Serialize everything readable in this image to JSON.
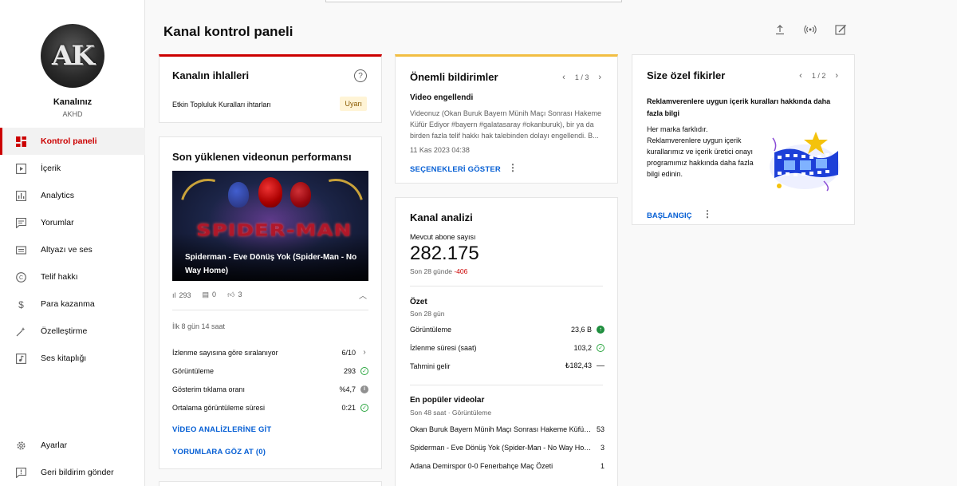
{
  "sidebar": {
    "avatar_text": "AK",
    "channel_name": "Kanalınız",
    "channel_handle": "AKHD",
    "items": [
      {
        "label": "Kontrol paneli",
        "icon": "dashboard-icon",
        "active": true
      },
      {
        "label": "İçerik",
        "icon": "content-icon"
      },
      {
        "label": "Analytics",
        "icon": "analytics-icon"
      },
      {
        "label": "Yorumlar",
        "icon": "comments-icon"
      },
      {
        "label": "Altyazı ve ses",
        "icon": "subtitles-icon"
      },
      {
        "label": "Telif hakkı",
        "icon": "copyright-icon"
      },
      {
        "label": "Para kazanma",
        "icon": "dollar-icon"
      },
      {
        "label": "Özelleştirme",
        "icon": "magic-wand-icon"
      },
      {
        "label": "Ses kitaplığı",
        "icon": "audio-library-icon"
      }
    ],
    "bottom_items": [
      {
        "label": "Ayarlar",
        "icon": "gear-icon"
      },
      {
        "label": "Geri bildirim gönder",
        "icon": "feedback-icon"
      }
    ]
  },
  "header": {
    "title": "Kanal kontrol paneli",
    "icons": [
      "upload-icon",
      "live-icon",
      "edit-icon"
    ]
  },
  "violations": {
    "title": "Kanalın ihlalleri",
    "text": "Etkin Topluluk Kuralları ihtarları",
    "badge": "Uyarı"
  },
  "performance": {
    "title": "Son yüklenen videonun performansı",
    "video_title": "Spiderman - Eve Dönüş Yok (Spider-Man - No Way Home)",
    "thumb_logo": "SPIDER-MAN",
    "views_icon_value": "293",
    "comments_value": "0",
    "likes_value": "3",
    "period": "İlk 8 gün 14 saat",
    "rows": [
      {
        "label": "İzlenme sayısına göre sıralanıyor",
        "value": "6/10",
        "status": "chevron"
      },
      {
        "label": "Görüntüleme",
        "value": "293",
        "status": "ok"
      },
      {
        "label": "Gösterim tıklama oranı",
        "value": "%4,7",
        "status": "info"
      },
      {
        "label": "Ortalama görüntüleme süresi",
        "value": "0:21",
        "status": "ok"
      }
    ],
    "link1": "VİDEO ANALİZLERİNE GİT",
    "link2": "YORUMLARA GÖZ AT (0)"
  },
  "notifications": {
    "title": "Önemli bildirimler",
    "pager": "1 / 3",
    "sub_title": "Video engellendi",
    "body": "Videonuz (Okan Buruk Bayern Münih Maçı Sonrası Hakeme Küfür Ediyor #bayern #galatasaray #okanburuk), bir ya da birden fazla telif hakkı hak talebinden dolayı engellendi. B...",
    "date": "11 Kas 2023 04:38",
    "link": "SEÇENEKLERİ GÖSTER"
  },
  "analytics": {
    "title": "Kanal analizi",
    "subs_label": "Mevcut abone sayısı",
    "subs_value": "282.175",
    "subs_change_prefix": "Son 28 günde ",
    "subs_change_value": "-406",
    "summary_title": "Özet",
    "summary_sub": "Son 28 gün",
    "summary_rows": [
      {
        "label": "Görüntüleme",
        "value": "23,6 B",
        "status": "up"
      },
      {
        "label": "İzlenme süresi (saat)",
        "value": "103,2",
        "status": "ok"
      },
      {
        "label": "Tahmini gelir",
        "value": "₺182,43",
        "status": "dash"
      }
    ],
    "top_title": "En popüler videolar",
    "top_sub": "Son 48 saat · Görüntüleme",
    "top_rows": [
      {
        "label": "Okan Buruk Bayern Münih Maçı Sonrası Hakeme Küfür Ediyor #bayern #galatasaray",
        "value": "53"
      },
      {
        "label": "Spiderman - Eve Dönüş Yok (Spider-Man - No Way Home)",
        "value": "3"
      },
      {
        "label": "Adana Demirspor 0-0 Fenerbahçe Maç Özeti",
        "value": "1"
      }
    ]
  },
  "ideas": {
    "title": "Size özel fikirler",
    "pager": "1 / 2",
    "head": "Reklamverenlere uygun içerik kuralları hakkında daha fazla bilgi",
    "body": "Her marka farklıdır. Reklamverenlere uygun içerik kurallarımız ve içerik üretici onayı programımız hakkında daha fazla bilgi edinin.",
    "link": "BAŞLANGIÇ"
  }
}
